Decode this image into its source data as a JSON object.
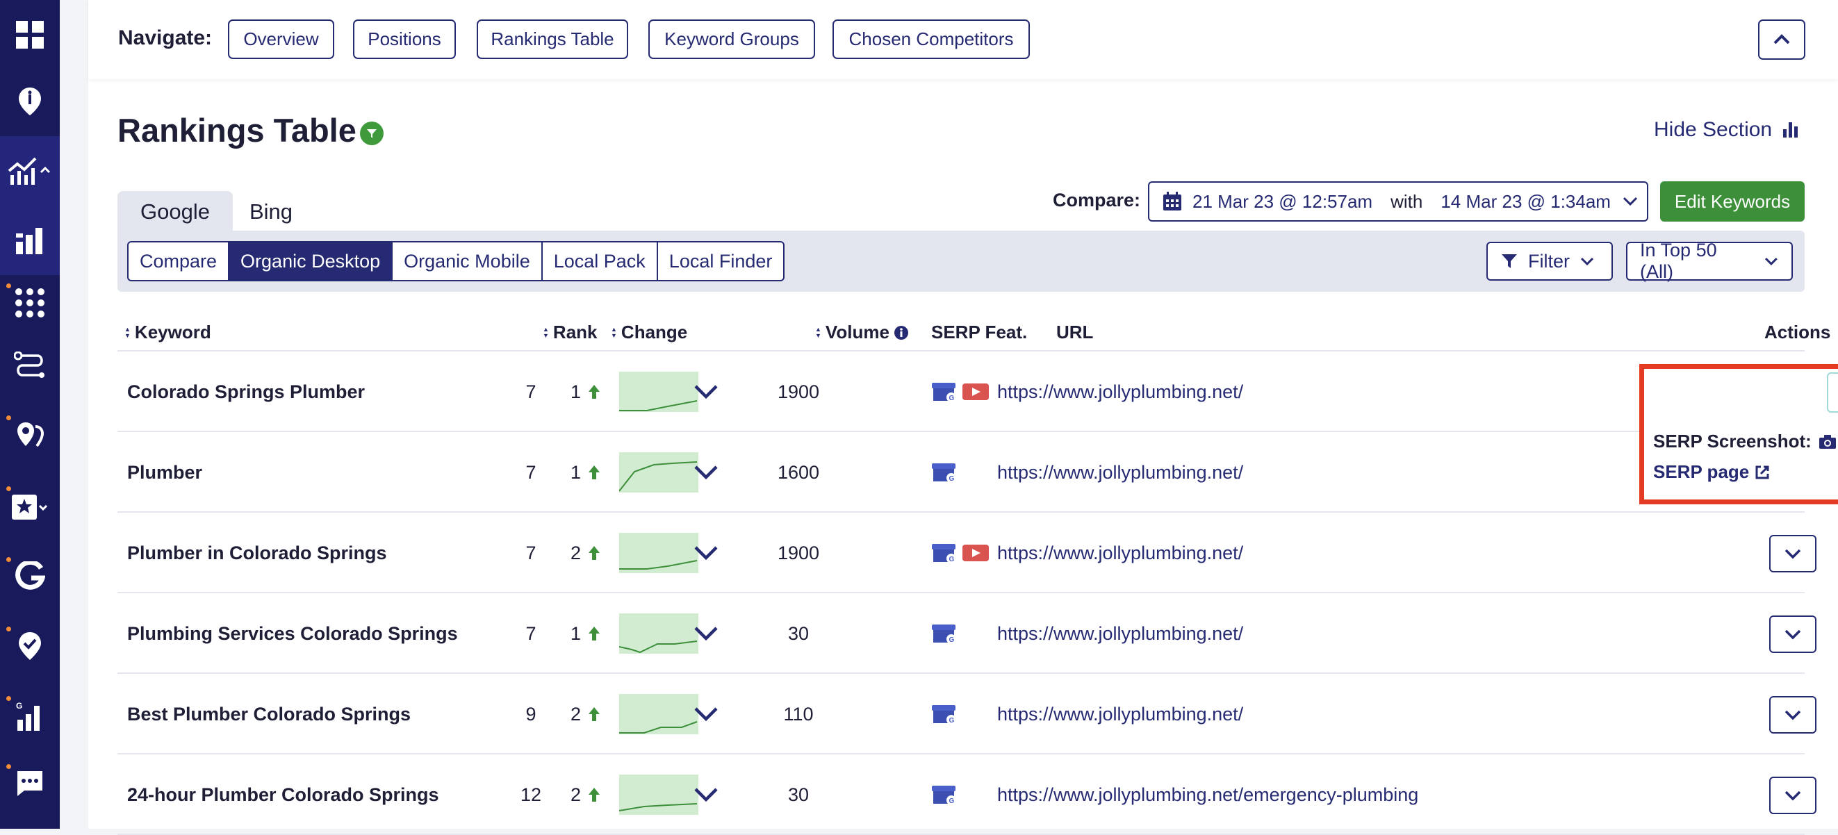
{
  "sidebar": {
    "icons": [
      "dashboard-icon",
      "location-pin-icon",
      "analytics-chart-icon",
      "bar-chart-icon",
      "grid-dots-icon",
      "route-icon",
      "map-pin-icon",
      "star-review-icon",
      "google-icon",
      "check-pin-icon",
      "google-rank-icon",
      "chat-icon"
    ]
  },
  "nav": {
    "label": "Navigate:",
    "buttons": [
      "Overview",
      "Positions",
      "Rankings Table",
      "Keyword Groups",
      "Chosen Competitors"
    ]
  },
  "section": {
    "title": "Rankings Table",
    "hide_label": "Hide Section"
  },
  "engines": [
    "Google",
    "Bing"
  ],
  "compare": {
    "label": "Compare:",
    "from": "21 Mar 23 @ 12:57am",
    "with": "with",
    "to": "14 Mar 23 @ 1:34am",
    "edit_label": "Edit Keywords"
  },
  "subtabs": [
    "Compare",
    "Organic Desktop",
    "Organic Mobile",
    "Local Pack",
    "Local Finder"
  ],
  "filters": {
    "filter_label": "Filter",
    "top_label": "In Top 50 (All)"
  },
  "table": {
    "headers": {
      "keyword": "Keyword",
      "rank": "Rank",
      "change": "Change",
      "volume": "Volume",
      "serp": "SERP Feat.",
      "url": "URL",
      "actions": "Actions"
    },
    "rows": [
      {
        "keyword": "Colorado Springs Plumber",
        "rank": "7",
        "change": "1",
        "volume": "1900",
        "url": "https://www.jollyplumbing.net/"
      },
      {
        "keyword": "Plumber",
        "rank": "7",
        "change": "1",
        "volume": "1600",
        "url": "https://www.jollyplumbing.net/"
      },
      {
        "keyword": "Plumber in Colorado Springs",
        "rank": "7",
        "change": "2",
        "volume": "1900",
        "url": "https://www.jollyplumbing.net/"
      },
      {
        "keyword": "Plumbing Services Colorado Springs",
        "rank": "7",
        "change": "1",
        "volume": "30",
        "url": "https://www.jollyplumbing.net/"
      },
      {
        "keyword": "Best Plumber Colorado Springs",
        "rank": "9",
        "change": "2",
        "volume": "110",
        "url": "https://www.jollyplumbing.net/"
      },
      {
        "keyword": "24-hour Plumber Colorado Springs",
        "rank": "12",
        "change": "2",
        "volume": "30",
        "url": "https://www.jollyplumbing.net/emergency-plumbing"
      }
    ]
  },
  "popup": {
    "screenshot_label": "SERP Screenshot:",
    "page_label": "SERP page"
  },
  "colors": {
    "sidebar": "#181a5c",
    "primary": "#262a72",
    "green": "#3d8f3a",
    "highlight": "#e53b24"
  }
}
